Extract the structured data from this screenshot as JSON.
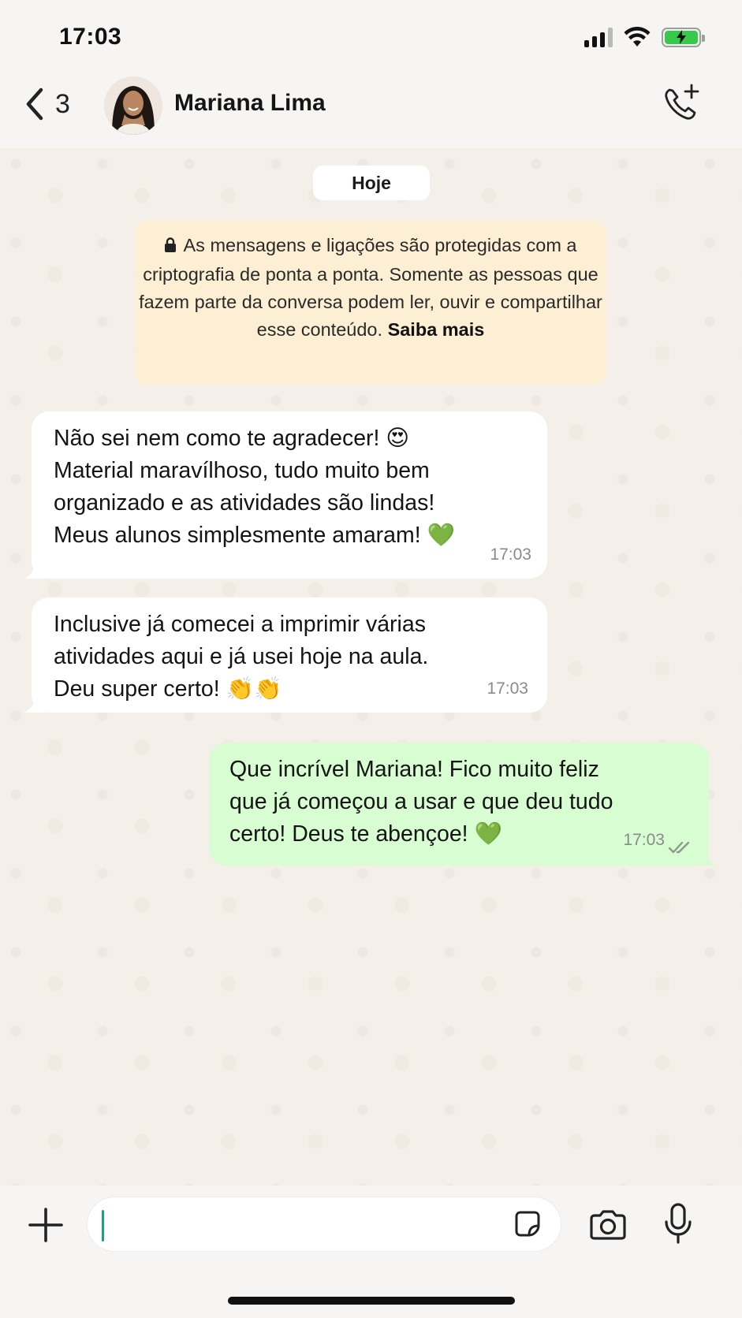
{
  "status_bar": {
    "time": "17:03",
    "battery_color": "#38c94c"
  },
  "header": {
    "back_count": "3",
    "contact_name": "Mariana Lima"
  },
  "chat": {
    "date_label": "Hoje",
    "encryption_notice": {
      "text": "As mensagens e ligações são protegidas com a criptografia de ponta a ponta. Somente as pessoas que fazem parte da conversa podem ler, ouvir e compartilhar esse conteúdo.",
      "link": "Saiba mais"
    },
    "messages": [
      {
        "direction": "incoming",
        "text": "Não sei nem como te agradecer! 😍\nMaterial maravílhoso, tudo muito bem\norganizado e as atividades são lindas!\nMeus alunos simplesmente amaram! 💚",
        "time": "17:03"
      },
      {
        "direction": "incoming",
        "text": "Inclusive já comecei a imprimir várias\natividades aqui e já usei hoje na aula.\nDeu super certo! 👏👏",
        "time": "17:03"
      },
      {
        "direction": "outgoing",
        "text": "Que incrível Mariana! Fico muito feliz\nque já começou a usar e que deu tudo\ncerto! Deus te abençoe! 💚",
        "time": "17:03",
        "status": "read"
      }
    ]
  },
  "composer": {
    "placeholder": "",
    "value": ""
  },
  "colors": {
    "incoming_bubble": "#ffffff",
    "outgoing_bubble": "#d9fdd3",
    "encryption_bg": "#fcefd3",
    "accent": "#1aa27a"
  }
}
